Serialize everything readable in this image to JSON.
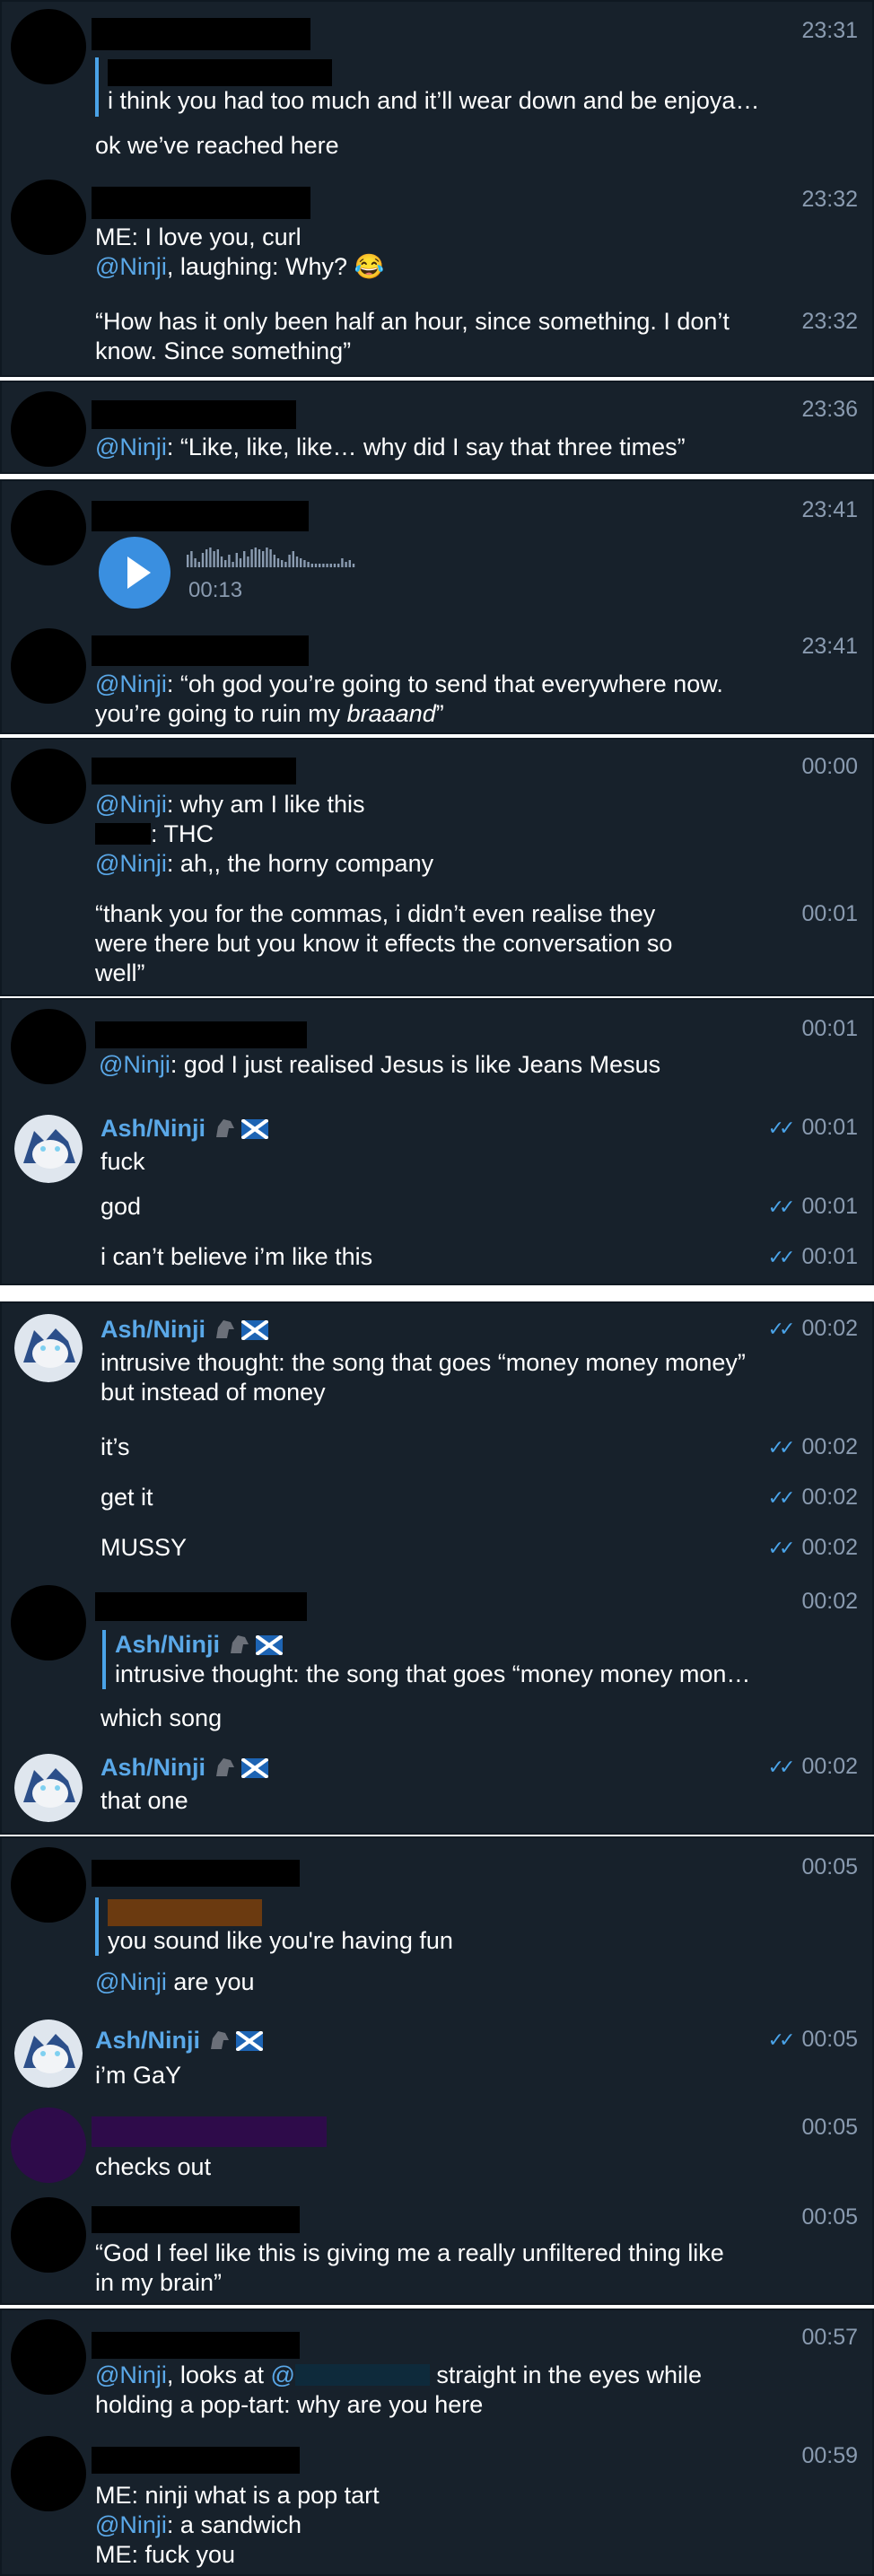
{
  "colors": {
    "panel_bg": "#17212b",
    "mention": "#5aa8e8",
    "time": "#8a9bb0",
    "accent": "#3a8fe0",
    "redact_brown": "#6b3a10",
    "redact_teal": "#0e2a3b",
    "avatar_purple": "#2e0b4a"
  },
  "icons": {
    "double_check": "double-check-icon",
    "play": "play-icon",
    "laugh": "laughing-emoji",
    "horse": "horse-emoji",
    "flag": "scotland-flag"
  },
  "p1": {
    "t1": "23:31",
    "q1": "i think you had too much and it’ll wear down and be enjoya…",
    "m1": "ok we’ve reached here",
    "t2": "23:32",
    "m2a": "ME: I love you, curl",
    "m2b_mention": "@Ninji",
    "m2b_text": ", laughing: Why?",
    "emoji_laugh": "😂",
    "t3": "23:32",
    "m3": "“How has it only been half an hour, since something. I don’t know. Since something”"
  },
  "p2": {
    "t1": "23:36",
    "mention": "@Ninji",
    "text": ": “Like, like, like… why did I say that three times”"
  },
  "p3": {
    "t1": "23:41",
    "duration": "00:13",
    "t2": "23:41",
    "mention": "@Ninji",
    "text_a": ": “oh god you’re going to send that everywhere now. you’re going to ruin my ",
    "text_em": "braaand",
    "text_b": "”"
  },
  "p4": {
    "t1": "00:00",
    "l1_mention": "@Ninji",
    "l1_text": ": why am I like this",
    "l2_text": ": THC",
    "l3_mention": "@Ninji",
    "l3_text": ": ah,, the horny company",
    "t2": "00:01",
    "m2": "“thank you for the commas, i didn’t even realise they were there but you know it effects the conversation so well”"
  },
  "p5": {
    "t1": "00:01",
    "mention": "@Ninji",
    "text": ": god I just realised Jesus is like Jeans Mesus",
    "ash_name": "Ash/Ninji",
    "t2": "00:01",
    "m2": "fuck",
    "t3": "00:01",
    "m3": "god",
    "t4": "00:01",
    "m4": "i can’t believe i’m like this"
  },
  "p6": {
    "ash_name": "Ash/Ninji",
    "t1": "00:02",
    "m1": "intrusive thought: the song that goes “money money money” but instead of money",
    "t2": "00:02",
    "m2": "it’s",
    "t3": "00:02",
    "m3": "get it",
    "t4": "00:02",
    "m4": "MUSSY",
    "t5": "00:02",
    "q_name": "Ash/Ninji",
    "q_text": "intrusive thought: the song that goes “money money mon…",
    "m5": "which song",
    "t6": "00:02",
    "m6": "that one"
  },
  "p7": {
    "t1": "00:05",
    "q_text": "you sound like you're having fun",
    "m1_mention": "@Ninji",
    "m1_text": " are you",
    "ash_name": "Ash/Ninji",
    "t2": "00:05",
    "m2": "i’m GaY",
    "t3": "00:05",
    "m3": "checks out",
    "t4": "00:05",
    "m4": "“God I feel like this is giving me a really unfiltered thing like in my brain”"
  },
  "p8": {
    "t1": "00:57",
    "m1_mention": "@Ninji",
    "m1_a": ", looks at ",
    "m1_mention2": "@",
    "m1_b": " straight in the eyes while holding a pop-tart: why are you here",
    "t2": "00:59",
    "l1": "ME: ninji what is a pop tart",
    "l2_mention": "@Ninji",
    "l2_text": ": a sandwich",
    "l3": "ME: fuck you"
  }
}
